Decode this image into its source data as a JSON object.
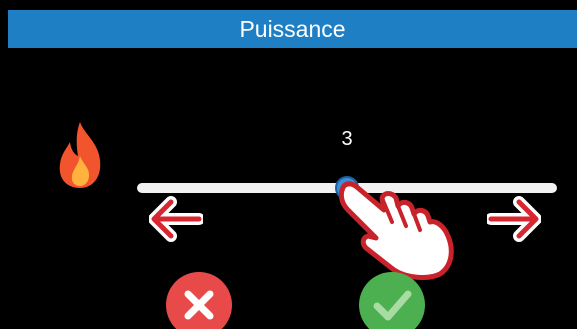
{
  "screen": {
    "title": "Puissance",
    "background_color": "#000000",
    "accent_color": "#1f7fc4"
  },
  "slider": {
    "value": "3",
    "min": 1,
    "max": 5,
    "fraction": 0.5
  },
  "icons": {
    "power_icon": "flame-icon",
    "decrease": "arrow-left-icon",
    "increase": "arrow-right-icon",
    "gesture": "pointing-hand-icon",
    "cancel": "close-icon",
    "confirm": "checkmark-icon"
  },
  "colors": {
    "cancel": "#e84a4a",
    "confirm": "#4caf50",
    "arrow": "#d6262f",
    "flame": "#f2542d"
  }
}
